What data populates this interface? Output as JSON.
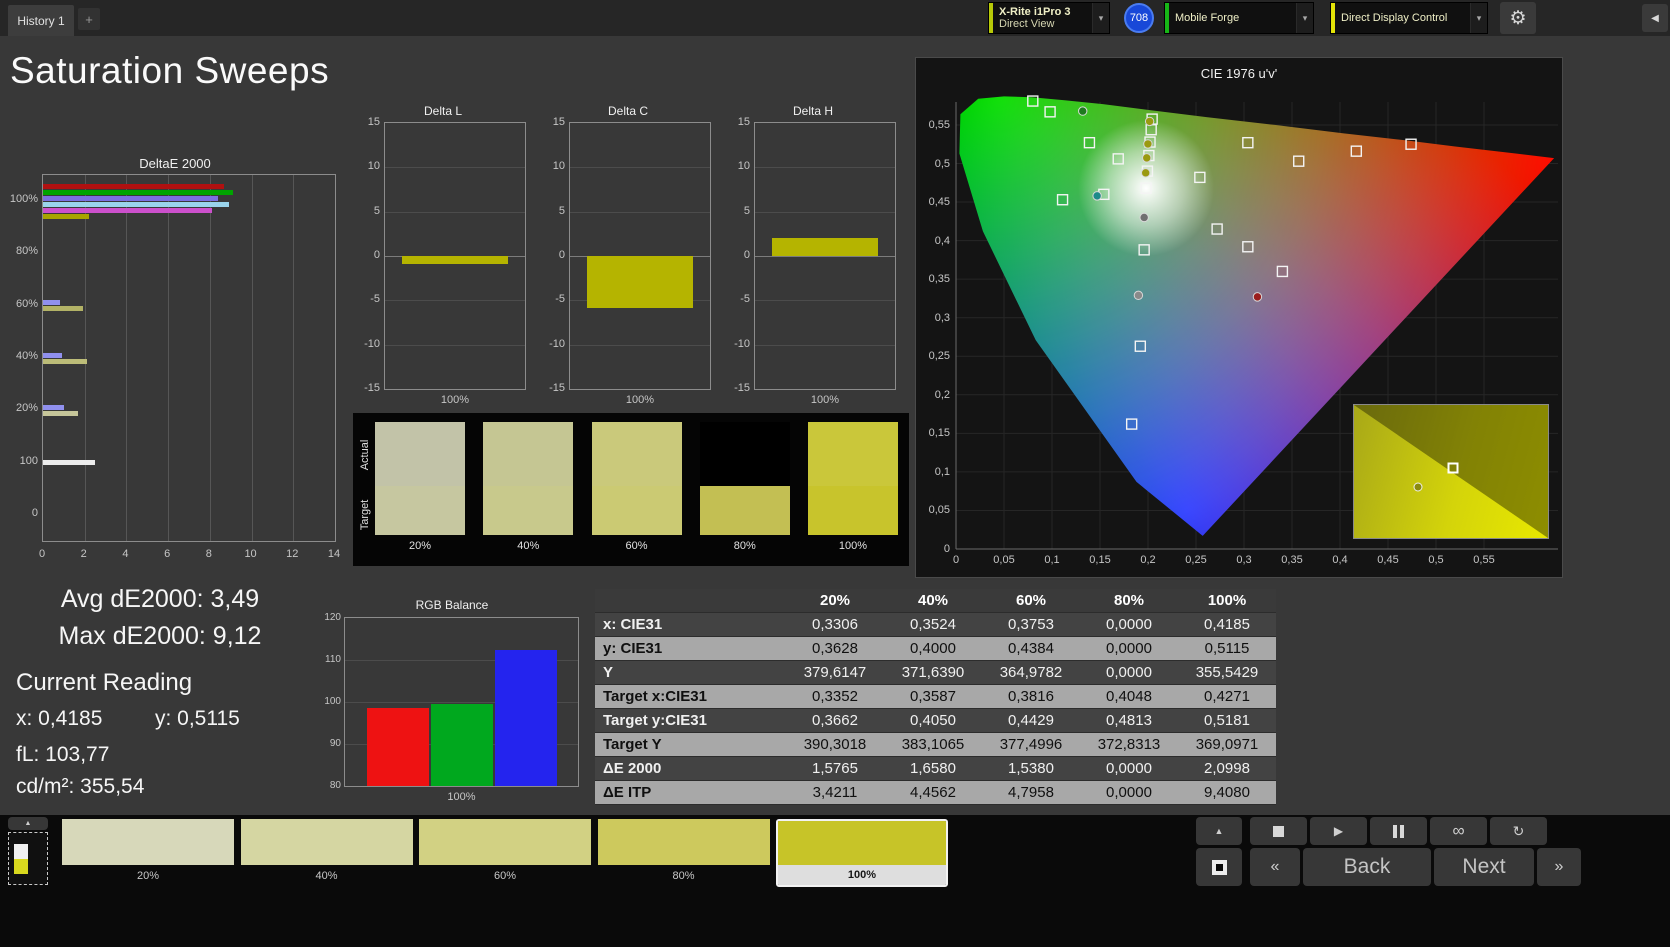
{
  "topbar": {
    "history_tab": "History 1",
    "meter_dropdown": {
      "line1": "X-Rite i1Pro 3",
      "line2": "Direct View",
      "accent": "#b7c908"
    },
    "badge": {
      "value": "708",
      "bg": "#1848d8",
      "ring": "#4a7cf0"
    },
    "source_dropdown": {
      "label": "Mobile Forge",
      "accent": "#17b617"
    },
    "control_dropdown": {
      "label": "Direct Display Control",
      "accent": "#e3e307"
    }
  },
  "page_title": "Saturation Sweeps",
  "icons": {
    "add": "+",
    "chevron_down": "▾",
    "gear": "⚙",
    "collapse_left": "◀",
    "up_arrow": "▲",
    "play": "▶",
    "infinity": "∞",
    "refresh": "↻",
    "prev_chevrons": "«",
    "next_chevrons": "»"
  },
  "stats": {
    "avg_de2000": "Avg dE2000: 3,49",
    "max_de2000": "Max dE2000: 9,12",
    "current_reading_title": "Current Reading",
    "x_value": "x: 0,4185",
    "y_value": "y: 0,5115",
    "fl_value": "fL: 103,77",
    "cdm2_value": "cd/m²: 355,54"
  },
  "patch_compare": {
    "row_labels": [
      "Actual",
      "Target"
    ],
    "patches": [
      {
        "label": "20%",
        "actual": "#c2c3a8",
        "target": "#c6c7a0"
      },
      {
        "label": "40%",
        "actual": "#c5c693",
        "target": "#c8c98c"
      },
      {
        "label": "60%",
        "actual": "#cac97b",
        "target": "#cbca73"
      },
      {
        "label": "80%",
        "actual": "#000000",
        "target": "#c3bf53"
      },
      {
        "label": "100%",
        "actual": "#cac73a",
        "target": "#c8c42c"
      }
    ]
  },
  "table": {
    "header": [
      "",
      "20%",
      "40%",
      "60%",
      "80%",
      "100%"
    ],
    "rows": [
      {
        "label": "x: CIE31",
        "values": [
          "0,3306",
          "0,3524",
          "0,3753",
          "0,0000",
          "0,4185"
        ]
      },
      {
        "label": "y: CIE31",
        "values": [
          "0,3628",
          "0,4000",
          "0,4384",
          "0,0000",
          "0,5115"
        ]
      },
      {
        "label": "Y",
        "values": [
          "379,6147",
          "371,6390",
          "364,9782",
          "0,0000",
          "355,5429"
        ]
      },
      {
        "label": "Target x:CIE31",
        "values": [
          "0,3352",
          "0,3587",
          "0,3816",
          "0,4048",
          "0,4271"
        ]
      },
      {
        "label": "Target y:CIE31",
        "values": [
          "0,3662",
          "0,4050",
          "0,4429",
          "0,4813",
          "0,5181"
        ]
      },
      {
        "label": "Target Y",
        "values": [
          "390,3018",
          "383,1065",
          "377,4996",
          "372,8313",
          "369,0971"
        ]
      },
      {
        "label": "ΔE 2000",
        "values": [
          "1,5765",
          "1,6580",
          "1,5380",
          "0,0000",
          "2,0998"
        ]
      },
      {
        "label": "ΔE ITP",
        "values": [
          "3,4211",
          "4,4562",
          "4,7958",
          "0,0000",
          "9,4080"
        ]
      }
    ]
  },
  "bottombar": {
    "back_label": "Back",
    "next_label": "Next",
    "swatches": [
      {
        "label": "20%",
        "color": "#d7d8ba",
        "selected": false
      },
      {
        "label": "40%",
        "color": "#d5d6a2",
        "selected": false
      },
      {
        "label": "60%",
        "color": "#d2d183",
        "selected": false
      },
      {
        "label": "80%",
        "color": "#cdc95d",
        "selected": false
      },
      {
        "label": "100%",
        "color": "#c7c428",
        "selected": true
      }
    ]
  },
  "chart_data": [
    {
      "id": "deltaE2000",
      "type": "bar",
      "orientation": "horizontal",
      "title": "DeltaE 2000",
      "xlim": [
        0,
        14
      ],
      "xticks": [
        0,
        2,
        4,
        6,
        8,
        10,
        12,
        14
      ],
      "groups": [
        {
          "label": "100%",
          "bars": [
            {
              "color": "#b01010",
              "value": 8.7
            },
            {
              "color": "#00a400",
              "value": 9.12
            },
            {
              "color": "#7a70e0",
              "value": 8.4
            },
            {
              "color": "#9ad4ec",
              "value": 8.9
            },
            {
              "color": "#cc50cc",
              "value": 8.1
            },
            {
              "color": "#a8a400",
              "value": 2.2
            }
          ]
        },
        {
          "label": "80%",
          "bars": []
        },
        {
          "label": "60%",
          "bars": [
            {
              "color": "#9090ee",
              "value": 0.8
            },
            {
              "color": "#b2b266",
              "value": 1.9
            }
          ]
        },
        {
          "label": "40%",
          "bars": [
            {
              "color": "#9090ee",
              "value": 0.9
            },
            {
              "color": "#bcbc78",
              "value": 2.1
            }
          ]
        },
        {
          "label": "20%",
          "bars": [
            {
              "color": "#9090ee",
              "value": 1.0
            },
            {
              "color": "#c6c69a",
              "value": 1.7
            }
          ]
        },
        {
          "label": "100",
          "bars": [
            {
              "color": "#ececec",
              "value": 2.5
            }
          ]
        },
        {
          "label": "0",
          "bars": []
        }
      ]
    },
    {
      "id": "deltaL",
      "type": "bar",
      "title": "Delta L",
      "xlabel": "100%",
      "ylim": [
        -15,
        15
      ],
      "yticks": [
        15,
        10,
        5,
        0,
        -5,
        -10,
        -15
      ],
      "categories": [
        "100%"
      ],
      "values": [
        -0.9
      ],
      "bar_color": "#b5b400"
    },
    {
      "id": "deltaC",
      "type": "bar",
      "title": "Delta C",
      "xlabel": "100%",
      "ylim": [
        -15,
        15
      ],
      "yticks": [
        15,
        10,
        5,
        0,
        -5,
        -10,
        -15
      ],
      "categories": [
        "100%"
      ],
      "values": [
        -5.9
      ],
      "bar_color": "#b5b400"
    },
    {
      "id": "deltaH",
      "type": "bar",
      "title": "Delta H",
      "xlabel": "100%",
      "ylim": [
        -15,
        15
      ],
      "yticks": [
        15,
        10,
        5,
        0,
        -5,
        -10,
        -15
      ],
      "categories": [
        "100%"
      ],
      "values": [
        2.0
      ],
      "bar_color": "#b5b400"
    },
    {
      "id": "rgbBalance",
      "type": "bar",
      "title": "RGB Balance",
      "xlabel": "100%",
      "ylim": [
        80,
        120
      ],
      "yticks": [
        120,
        110,
        100,
        90,
        80
      ],
      "categories": [
        "Red",
        "Green",
        "Blue"
      ],
      "values": [
        98.5,
        99.5,
        112.5
      ],
      "colors": [
        "#ee1212",
        "#00a81e",
        "#2424ee"
      ]
    },
    {
      "id": "cie1976",
      "type": "scatter",
      "title": "CIE 1976 u'v'",
      "xlim": [
        0,
        0.62
      ],
      "ylim": [
        0,
        0.62
      ],
      "tick_step": 0.05,
      "ticks": [
        "0",
        "0,05",
        "0,1",
        "0,15",
        "0,2",
        "0,25",
        "0,3",
        "0,35",
        "0,4",
        "0,45",
        "0,5",
        "0,55"
      ],
      "locus": [
        [
          0.0035,
          0.513
        ],
        [
          0.0046,
          0.564
        ],
        [
          0.0231,
          0.584
        ],
        [
          0.05,
          0.587
        ],
        [
          0.079,
          0.586
        ],
        [
          0.113,
          0.582
        ],
        [
          0.153,
          0.577
        ],
        [
          0.203,
          0.569
        ],
        [
          0.262,
          0.56
        ],
        [
          0.332,
          0.55
        ],
        [
          0.404,
          0.539
        ],
        [
          0.469,
          0.53
        ],
        [
          0.52,
          0.522
        ],
        [
          0.583,
          0.513
        ],
        [
          0.623,
          0.507
        ],
        [
          0.257,
          0.017
        ],
        [
          0.188,
          0.087
        ],
        [
          0.083,
          0.271
        ],
        [
          0.028,
          0.412
        ]
      ],
      "targets": [
        [
          0.08,
          0.581
        ],
        [
          0.098,
          0.567
        ],
        [
          0.139,
          0.527
        ],
        [
          0.169,
          0.506
        ],
        [
          0.111,
          0.453
        ],
        [
          0.154,
          0.46
        ],
        [
          0.198,
          0.468
        ],
        [
          0.1994,
          0.4901
        ],
        [
          0.2009,
          0.5103
        ],
        [
          0.2021,
          0.5278
        ],
        [
          0.2033,
          0.5438
        ],
        [
          0.2043,
          0.5576
        ],
        [
          0.254,
          0.482
        ],
        [
          0.304,
          0.527
        ],
        [
          0.357,
          0.503
        ],
        [
          0.417,
          0.516
        ],
        [
          0.474,
          0.525
        ],
        [
          0.272,
          0.415
        ],
        [
          0.304,
          0.392
        ],
        [
          0.34,
          0.36
        ],
        [
          0.196,
          0.388
        ],
        [
          0.192,
          0.263
        ],
        [
          0.183,
          0.162
        ]
      ],
      "measurements": [
        {
          "u": 0.1976,
          "v": 0.4879,
          "color": "#9a9a10"
        },
        {
          "u": 0.1987,
          "v": 0.5073,
          "color": "#9a9a10"
        },
        {
          "u": 0.1999,
          "v": 0.5254,
          "color": "#9a9a10"
        },
        {
          "u": 0.2017,
          "v": 0.5546,
          "color": "#9a9a10"
        },
        {
          "u": 0.132,
          "v": 0.568,
          "color": "#1e7a1e"
        },
        {
          "u": 0.147,
          "v": 0.458,
          "color": "#1e8a8a"
        },
        {
          "u": 0.196,
          "v": 0.43,
          "color": "#707070"
        },
        {
          "u": 0.19,
          "v": 0.329,
          "color": "#8a8a8a"
        },
        {
          "u": 0.314,
          "v": 0.327,
          "color": "#9a1e1e"
        }
      ],
      "inset": {
        "square": [
          0.51,
          0.47
        ],
        "dot": [
          0.33,
          0.62
        ]
      }
    }
  ]
}
